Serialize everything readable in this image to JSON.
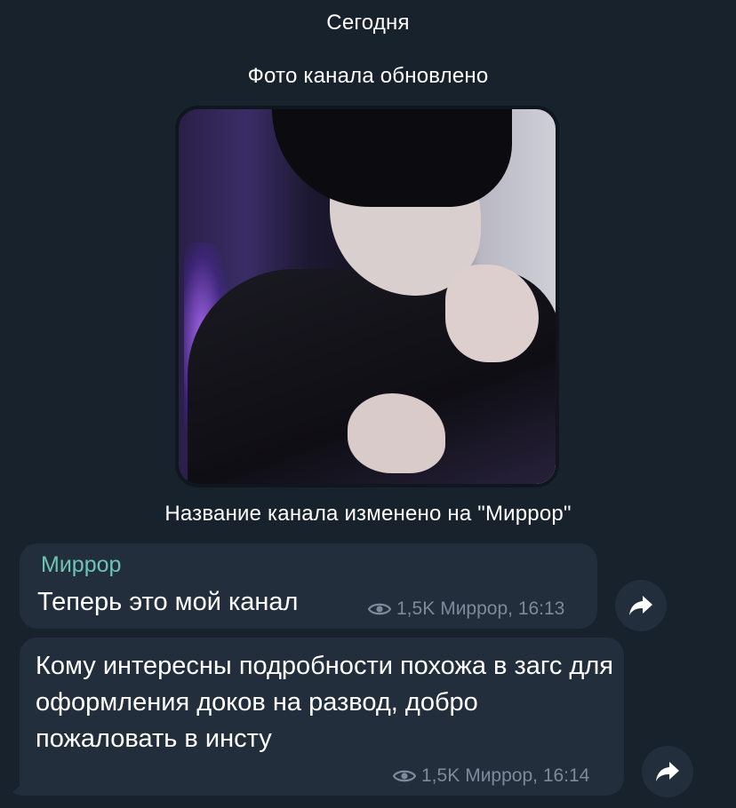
{
  "date_separator": "Сегодня",
  "service_messages": {
    "photo_updated": "Фото канала обновлено",
    "name_changed": "Название канала изменено на \"Миррор\""
  },
  "messages": [
    {
      "author": "Миррор",
      "text": "Теперь это мой канал",
      "views": "1,5K",
      "signature": "Миррор, 16:13"
    },
    {
      "text": "Кому интересны подробности похожа в загс для оформления доков на развод, добро пожаловать в инсту",
      "views": "1,5K",
      "signature": "Миррор, 16:14"
    }
  ],
  "icons": {
    "views": "eye-icon",
    "share": "share-arrow-icon"
  },
  "colors": {
    "background": "#18222d",
    "bubble": "#232e3c",
    "author": "#6ec3b5",
    "meta": "#7d8a99"
  }
}
